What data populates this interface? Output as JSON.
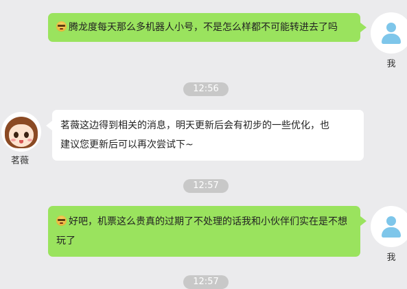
{
  "messages": [
    {
      "sender": "我",
      "text": "腾龙度每天那么多机器人小号，不是怎么样都不可能转进去了吗",
      "emoji": "emoji-icon"
    },
    {
      "sender": "茗薇",
      "line1": "茗薇这边得到相关的消息，明天更新后会有初步的一些优化，也",
      "line2": "建议您更新后可以再次尝试下~"
    },
    {
      "sender": "我",
      "line1": "好吧，机票这么贵真的过期了不处理的话我和小伙伴们实在是不想",
      "line2": "玩了",
      "emoji": "emoji-icon"
    }
  ],
  "timestamps": [
    "12:56",
    "12:57",
    "12:57"
  ],
  "colors": {
    "background": "#ebebed",
    "my_bubble": "#9ae35e",
    "other_bubble": "#ffffff",
    "timestamp_pill": "#c8c8c8",
    "avatar_icon": "#7ec6ea"
  }
}
